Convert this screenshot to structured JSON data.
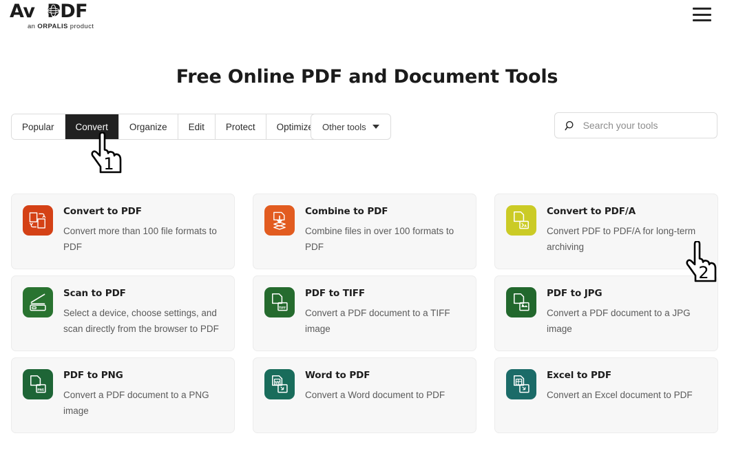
{
  "brand": {
    "name_left": "Av",
    "name_right": "PDF",
    "tagline_pre": "an ",
    "tagline_brand": "ORPALIS",
    "tagline_post": " product",
    "globe_icon": "globe-icon"
  },
  "header": {
    "menu_icon": "hamburger-menu-icon"
  },
  "title": "Free Online PDF and Document Tools",
  "tabs": [
    {
      "label": "Popular",
      "active": false
    },
    {
      "label": "Convert",
      "active": true
    },
    {
      "label": "Organize",
      "active": false
    },
    {
      "label": "Edit",
      "active": false
    },
    {
      "label": "Protect",
      "active": false
    },
    {
      "label": "Optimize",
      "active": false
    }
  ],
  "other_tools": {
    "label": "Other tools",
    "caret_icon": "chevron-down-icon"
  },
  "search": {
    "placeholder": "Search your tools",
    "value": "",
    "icon": "search-icon"
  },
  "cards": [
    {
      "title": "Convert to PDF",
      "desc": "Convert more than 100 file formats to PDF",
      "icon": "convert-to-pdf-icon",
      "color": "#d44116"
    },
    {
      "title": "Combine to PDF",
      "desc": "Combine files in over 100 formats to PDF",
      "icon": "combine-to-pdf-icon",
      "color": "#e25c20"
    },
    {
      "title": "Convert to PDF/A",
      "desc": "Convert PDF to PDF/A for long-term archiving",
      "icon": "convert-to-pdfa-icon",
      "color": "#cbcb26"
    },
    {
      "title": "Scan to PDF",
      "desc": "Select a device, choose settings, and scan directly from the browser to PDF",
      "icon": "scan-to-pdf-icon",
      "color": "#297330"
    },
    {
      "title": "PDF to TIFF",
      "desc": "Convert a PDF document to a TIFF image",
      "icon": "pdf-to-tiff-icon",
      "color": "#256b2e"
    },
    {
      "title": "PDF to JPG",
      "desc": "Convert a PDF document to a JPG image",
      "icon": "pdf-to-jpg-icon",
      "color": "#22682d"
    },
    {
      "title": "PDF to PNG",
      "desc": "Convert a PDF document to a PNG image",
      "icon": "pdf-to-png-icon",
      "color": "#1e6536"
    },
    {
      "title": "Word to PDF",
      "desc": "Convert a Word document to PDF",
      "icon": "word-to-pdf-icon",
      "color": "#196c5b"
    },
    {
      "title": "Excel to PDF",
      "desc": "Convert an Excel document to PDF",
      "icon": "excel-to-pdf-icon",
      "color": "#1b6b68"
    }
  ],
  "annotations": [
    {
      "label": "1",
      "icon": "hand-pointer-cursor"
    },
    {
      "label": "2",
      "icon": "hand-pointer-cursor"
    }
  ]
}
